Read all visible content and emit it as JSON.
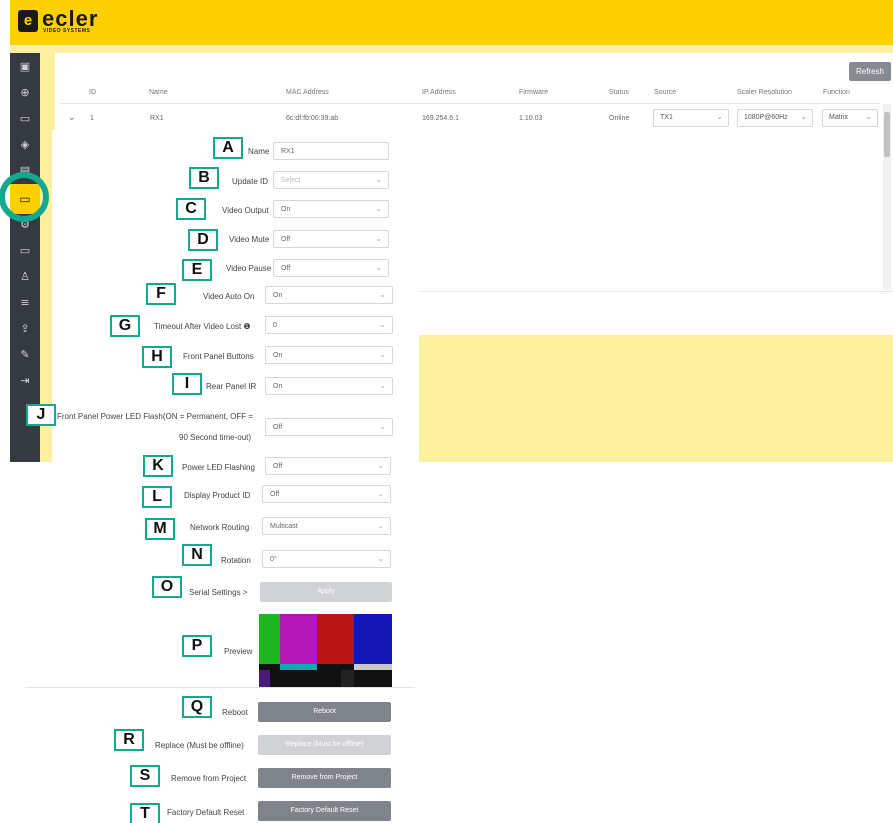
{
  "brand": {
    "logo_letter": "e",
    "name": "ecler",
    "subtitle": "VIDEO SYSTEMS",
    "accent_color": "#ffd000",
    "callout_color": "#12a98e"
  },
  "sidebar_icons": [
    "dashboard-icon",
    "add-icon",
    "device-list-icon",
    "layers-icon",
    "display-icon",
    "receiver-icon",
    "settings-icon",
    "grid-icon",
    "user-icon",
    "sliders-icon",
    "upload-icon",
    "tools-icon",
    "logout-icon"
  ],
  "toolbar": {
    "refresh_label": "Refresh"
  },
  "table": {
    "headers": {
      "id": "ID",
      "name": "Name",
      "mac": "MAC Address",
      "ip": "IP Address",
      "firmware": "Firmware",
      "status": "Status",
      "source": "Source",
      "scaler": "Scaler Resolution",
      "function": "Function"
    },
    "row": {
      "expand_glyph": "⌄",
      "id": "1",
      "name": "RX1",
      "mac": "6c:df:fb:00:39:ab",
      "ip": "169.254.6.1",
      "firmware": "1.10.03",
      "status": "Online",
      "source": "TX1",
      "scaler": "1080P@60Hz",
      "function": "Matrix"
    }
  },
  "form": {
    "name_label": "Name",
    "name_value": "RX1",
    "update_id_label": "Update ID",
    "update_id_placeholder": "Select",
    "video_output_label": "Video Output",
    "video_output_value": "On",
    "video_mute_label": "Video Mute",
    "video_mute_value": "Off",
    "video_pause_label": "Video Pause",
    "video_pause_value": "Off",
    "video_auto_on_label": "Video Auto On",
    "video_auto_on_value": "On",
    "timeout_label": "Timeout After Video Lost",
    "timeout_info_glyph": "❶",
    "timeout_value": "0",
    "front_panel_buttons_label": "Front Panel Buttons",
    "front_panel_buttons_value": "On",
    "rear_panel_ir_label": "Rear Panel IR",
    "rear_panel_ir_value": "On",
    "led_flash_label_1": "Front Panel Power LED Flash(ON = Permanent, OFF =",
    "led_flash_label_2": "90 Second time-out)",
    "led_flash_value": "Off",
    "power_led_flashing_label": "Power LED Flashing",
    "power_led_flashing_value": "Off",
    "display_product_id_label": "Display Product ID",
    "display_product_id_value": "Off",
    "network_routing_label": "Network Routing",
    "network_routing_value": "Multicast",
    "rotation_label": "Rotation",
    "rotation_value": "0°",
    "serial_settings_label": "Serial Settings",
    "serial_settings_arrow": ">",
    "apply_label": "Apply",
    "preview_label": "Preview",
    "reboot_label": "Reboot",
    "reboot_button": "Reboot",
    "replace_label": "Replace (Must be offline)",
    "replace_button": "Replace (Must be offline)",
    "remove_label": "Remove from Project",
    "remove_button": "Remove from Project",
    "factory_label": "Factory Default Reset",
    "factory_button": "Factory Default Reset"
  },
  "callouts": [
    "A",
    "B",
    "C",
    "D",
    "E",
    "F",
    "G",
    "H",
    "I",
    "J",
    "K",
    "L",
    "M",
    "N",
    "O",
    "P",
    "Q",
    "R",
    "S",
    "T"
  ],
  "preview_colors": {
    "top": [
      "#1fb51f",
      "#b317b8",
      "#b81414",
      "#1515b5"
    ],
    "mid": [
      "#1a1a1a",
      "#13a8b0",
      "#1a1a1a",
      "#c9c9c9"
    ],
    "bottom": [
      "#4a1a7a",
      "#0d0d0d",
      "#222222",
      "#0d0d0d"
    ]
  }
}
